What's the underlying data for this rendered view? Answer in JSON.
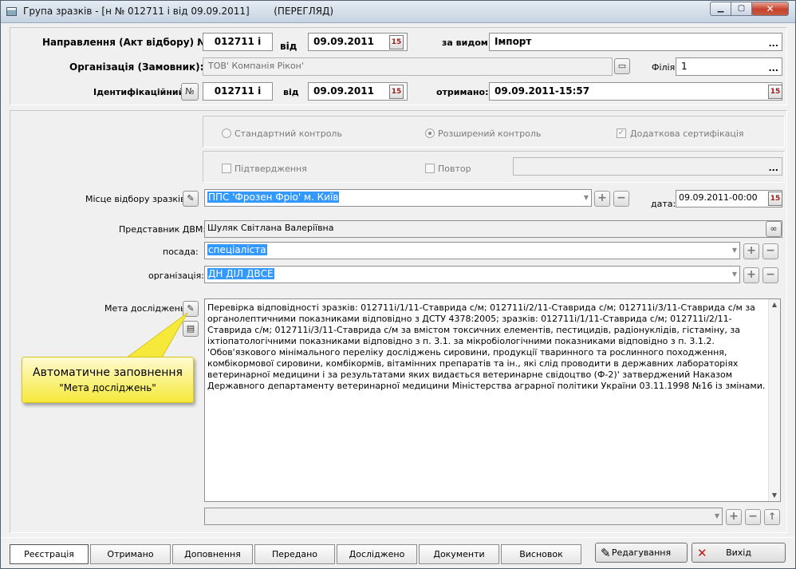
{
  "window": {
    "title": "Група зразків - [н № 012711 і від 09.09.2011]        (ПЕРЕГЛЯД)",
    "min_glyph": "▁",
    "max_glyph": "▢",
    "close_glyph": "✕"
  },
  "header": {
    "act_label": "Направлення (Акт відбору) №",
    "act_number": "012711 і",
    "from_label1": "від",
    "act_date": "09.09.2011",
    "by_type_label": "за видом:",
    "by_type_value": "Імпорт",
    "org_label": "Організація (Замовник):",
    "org_value": "ТОВ' Компанія Рікон'",
    "branch_label": "Філія:",
    "branch_value": "1",
    "ident_label": "Ідентифікаційний",
    "ident_btn": "№",
    "ident_number": "012711 і",
    "from_label2": "від",
    "ident_date": "09.09.2011",
    "received_label": "отримано:",
    "received_value": "09.09.2011-15:57",
    "ellipsis": "..."
  },
  "control": {
    "standard": "Стандартний контроль",
    "extended": "Розширений контроль",
    "extra_cert": "Додаткова сертифікація",
    "confirm": "Підтвердження",
    "repeat": "Повтор",
    "check_mark": "✓"
  },
  "sampling": {
    "place_label": "Місце відбору зразків:",
    "place_value": "ППС 'Фрозен Фріо' м. Київ",
    "date_label": "дата:",
    "date_value": "09.09.2011-00:00",
    "rep_label": "Представник ДВМ:",
    "rep_value": "Шуляк Світлана Валеріївна",
    "position_label": "посада:",
    "position_value": "спеціаліста",
    "org_label": "організація:",
    "org_value": "ДН ДІЛ ДВСЕ"
  },
  "purpose": {
    "label": "Мета досліджень:",
    "text": "Перевірка відповідності зразків: 012711і/1/11-Ставрида с/м; 012711і/2/11-Ставрида с/м; 012711і/3/11-Ставрида с/м за органолептичними показниками відповідно з ДСТУ 4378:2005; зразків: 012711і/1/11-Ставрида с/м; 012711і/2/11-Ставрида с/м; 012711і/3/11-Ставрида с/м за вмістом токсичних елементів,  пестицидів,  радіонуклідів,  гістаміну, за іхтіопатологічними показниками відповідно з п. 3.1.   за мікробіологічними показниками відповідно з п. 3.1.2. 'Обов'язкового мінімального переліку досліджень сировини, продукції тваринного та рослинного походження, комбікормової сировини, комбікормів, вітамінних препаратів та ін., які слід проводити в державних лабораторіях ветеринарної медицини і за результатами яких видається ветеринарне свідоцтво (Ф-2)' затверджений Наказом Державного департаменту ветеринарної медицини Міністерства аграрної політики України 03.11.1998 №16 із змінами."
  },
  "callout": {
    "line1": "Автоматичне заповнення",
    "line2": "\"Мета досліджень\""
  },
  "buttons": {
    "plus": "+",
    "minus": "−",
    "up": "↑"
  },
  "tabs": [
    {
      "label": "Реєстрація"
    },
    {
      "label": "Отримано"
    },
    {
      "label": "Доповнення"
    },
    {
      "label": "Передано"
    },
    {
      "label": "Досліджено"
    },
    {
      "label": "Документи"
    },
    {
      "label": "Висновок"
    }
  ],
  "actions": {
    "edit": "Редагування",
    "exit": "Вихід"
  }
}
